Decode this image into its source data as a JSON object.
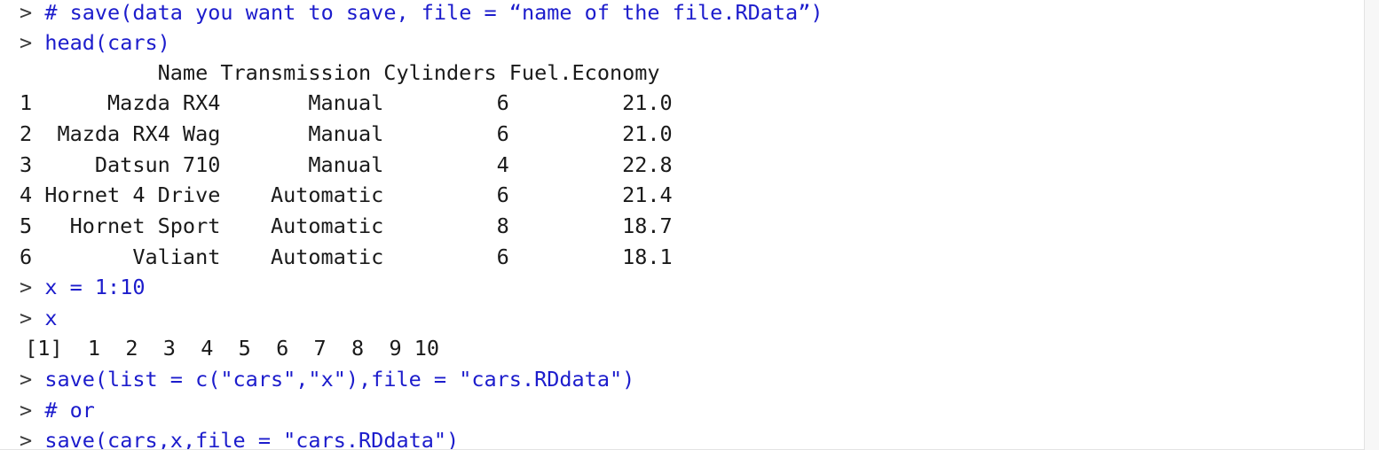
{
  "console": {
    "prompt": ">",
    "lines": [
      {
        "kind": "input",
        "text": "# save(data you want to save, file = “name of the file.RData”)"
      },
      {
        "kind": "input",
        "text": "head(cars)"
      },
      {
        "kind": "output",
        "text": "           Name Transmission Cylinders Fuel.Economy"
      },
      {
        "kind": "output",
        "text": "1      Mazda RX4       Manual         6         21.0"
      },
      {
        "kind": "output",
        "text": "2  Mazda RX4 Wag       Manual         6         21.0"
      },
      {
        "kind": "output",
        "text": "3     Datsun 710       Manual         4         22.8"
      },
      {
        "kind": "output",
        "text": "4 Hornet 4 Drive    Automatic         6         21.4"
      },
      {
        "kind": "output",
        "text": "5   Hornet Sport    Automatic         8         18.7"
      },
      {
        "kind": "output",
        "text": "6        Valiant    Automatic         6         18.1"
      },
      {
        "kind": "input",
        "text": "x = 1:10"
      },
      {
        "kind": "input",
        "text": "x"
      },
      {
        "kind": "output",
        "text": " [1]  1  2  3  4  5  6  7  8  9 10"
      },
      {
        "kind": "input",
        "text": "save(list = c(\"cars\",\"x\"),file = \"cars.RDdata\")"
      },
      {
        "kind": "input",
        "text": "# or"
      },
      {
        "kind": "input",
        "text": "save(cars,x,file = \"cars.RDdata\")"
      }
    ]
  }
}
